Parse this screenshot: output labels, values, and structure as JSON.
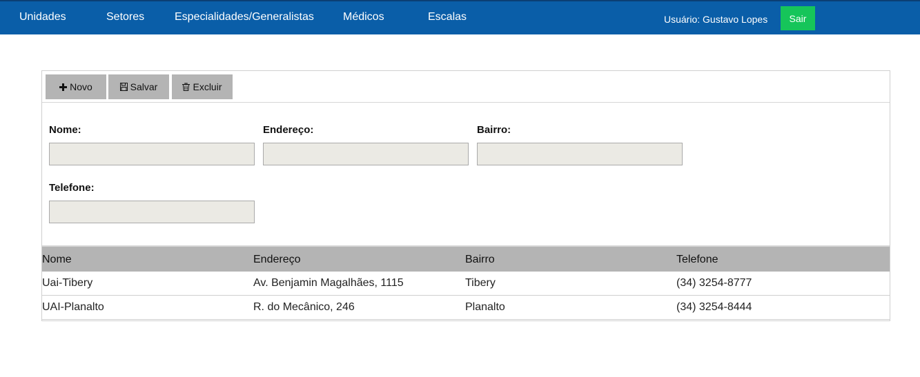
{
  "nav": {
    "items": [
      "Unidades",
      "Setores",
      "Especialidades/Generalistas",
      "Médicos",
      "Escalas"
    ],
    "user_label": "Usuário: Gustavo Lopes",
    "logout_label": "Sair"
  },
  "toolbar": {
    "new_label": "Novo",
    "save_label": "Salvar",
    "delete_label": "Excluir"
  },
  "form": {
    "nome_label": "Nome:",
    "endereco_label": "Endereço:",
    "bairro_label": "Bairro:",
    "telefone_label": "Telefone:",
    "nome_value": "",
    "endereco_value": "",
    "bairro_value": "",
    "telefone_value": ""
  },
  "table": {
    "headers": [
      "Nome",
      "Endereço",
      "Bairro",
      "Telefone"
    ],
    "rows": [
      [
        "Uai-Tibery",
        "Av. Benjamin Magalhães, 1115",
        "Tibery",
        "(34) 3254-8777"
      ],
      [
        "UAI-Planalto",
        "R. do Mecânico, 246",
        "Planalto",
        "(34) 3254-8444"
      ]
    ]
  },
  "colors": {
    "topbar": "#0a5ea8",
    "logout_button": "#16c55a",
    "toolbar_button": "#b4b4b4",
    "input_background": "#ebeae4",
    "table_header": "#b4b4b4"
  }
}
